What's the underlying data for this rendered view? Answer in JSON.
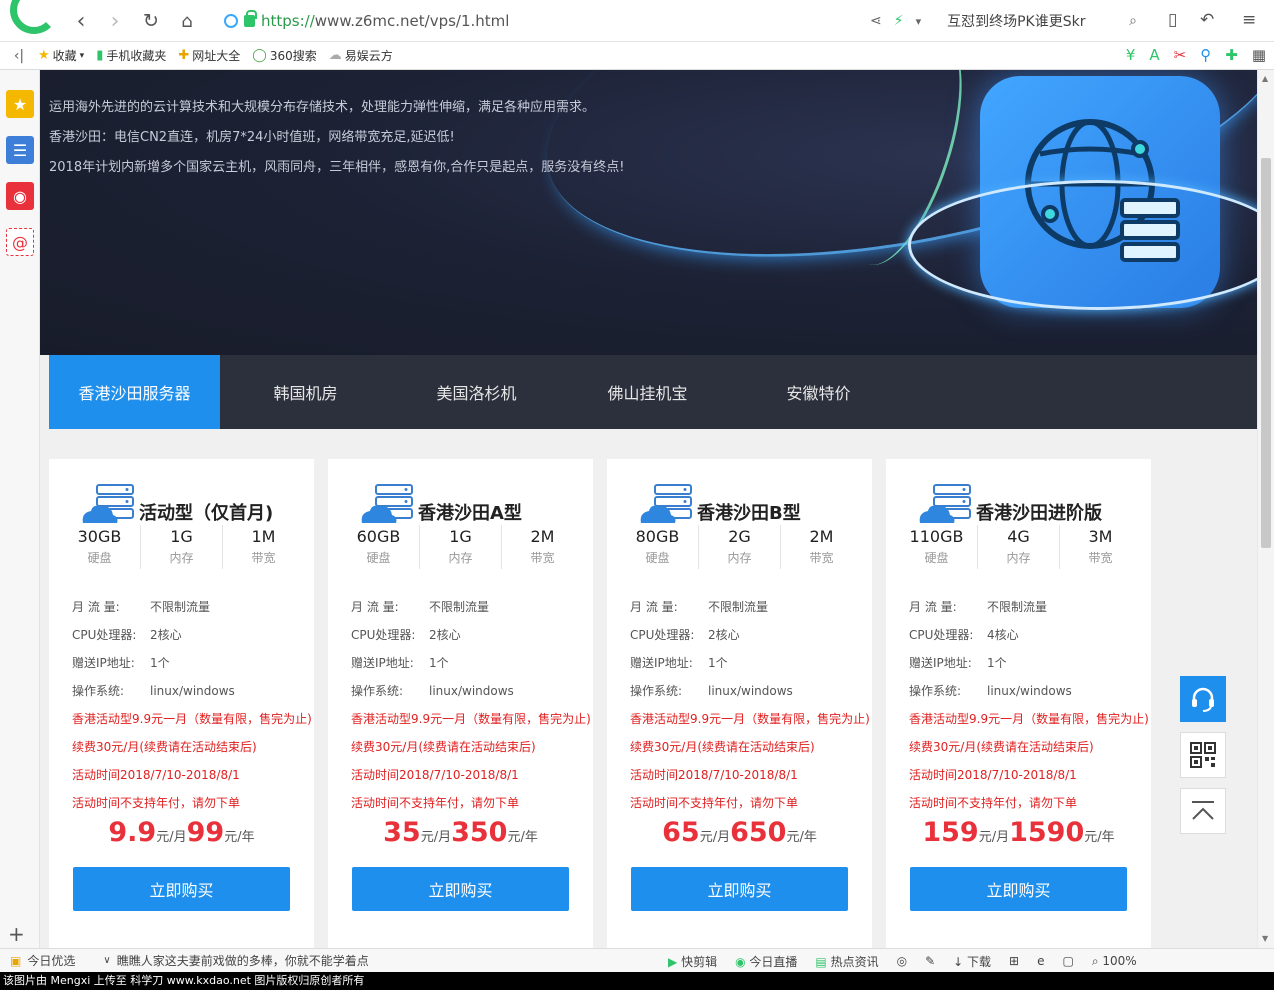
{
  "browser": {
    "url_prefix": "https://",
    "url_host": "www.z6mc.net",
    "url_path": "/vps/1.html",
    "news_ticker": "互怼到终场PK谁更Skr",
    "favorites": [
      {
        "icon": "star-icon",
        "label": "收藏"
      },
      {
        "icon": "phone-icon",
        "label": "手机收藏夹"
      },
      {
        "icon": "sites-icon",
        "label": "网址大全"
      },
      {
        "icon": "search-360-icon",
        "label": "360搜索"
      },
      {
        "icon": "cloud-icon",
        "label": "易娱云方"
      }
    ]
  },
  "banner": {
    "lines": [
      "运用海外先进的的云计算技术和大规模分布存储技术，处理能力弹性伸缩，满足各种应用需求。",
      "香港沙田：电信CN2直连，机房7*24小时值班，网络带宽充足,延迟低!",
      "2018年计划内新增多个国家云主机，风雨同舟，三年相伴，感恩有你,合作只是起点，服务没有终点!"
    ]
  },
  "tabs": [
    {
      "label": "香港沙田服务器",
      "active": true
    },
    {
      "label": "韩国机房",
      "active": false
    },
    {
      "label": "美国洛杉机",
      "active": false
    },
    {
      "label": "佛山挂机宝",
      "active": false
    },
    {
      "label": "安徽特价",
      "active": false
    }
  ],
  "spec_labels": {
    "disk": "硬盘",
    "ram": "内存",
    "bw": "带宽"
  },
  "feature_labels": {
    "traffic": "月 流 量:",
    "cpu": "CPU处理器:",
    "ip": "赠送IP地址:",
    "os": "操作系统:"
  },
  "price_units": {
    "month": "元/月",
    "year": "元/年"
  },
  "buy_label": "立即购买",
  "cards": [
    {
      "title": "活动型（仅首月)",
      "disk": "30GB",
      "ram": "1G",
      "bw": "1M",
      "traffic": "不限制流量",
      "cpu": "2核心",
      "ip": "1个",
      "os": "linux/windows",
      "notes": [
        "香港活动型9.9元一月（数量有限，售完为止)",
        "续费30元/月(续费请在活动结束后)",
        "活动时间2018/7/10-2018/8/1",
        "活动时间不支持年付，请勿下单"
      ],
      "price_month": "9.9",
      "price_year": "99"
    },
    {
      "title": "香港沙田A型",
      "disk": "60GB",
      "ram": "1G",
      "bw": "2M",
      "traffic": "不限制流量",
      "cpu": "2核心",
      "ip": "1个",
      "os": "linux/windows",
      "notes": [
        "香港活动型9.9元一月（数量有限，售完为止)",
        "续费30元/月(续费请在活动结束后)",
        "活动时间2018/7/10-2018/8/1",
        "活动时间不支持年付，请勿下单"
      ],
      "price_month": "35",
      "price_year": "350"
    },
    {
      "title": "香港沙田B型",
      "disk": "80GB",
      "ram": "2G",
      "bw": "2M",
      "traffic": "不限制流量",
      "cpu": "2核心",
      "ip": "1个",
      "os": "linux/windows",
      "notes": [
        "香港活动型9.9元一月（数量有限，售完为止)",
        "续费30元/月(续费请在活动结束后)",
        "活动时间2018/7/10-2018/8/1",
        "活动时间不支持年付，请勿下单"
      ],
      "price_month": "65",
      "price_year": "650"
    },
    {
      "title": "香港沙田进阶版",
      "disk": "110GB",
      "ram": "4G",
      "bw": "3M",
      "traffic": "不限制流量",
      "cpu": "4核心",
      "ip": "1个",
      "os": "linux/windows",
      "notes": [
        "香港活动型9.9元一月（数量有限，售完为止)",
        "续费30元/月(续费请在活动结束后)",
        "活动时间2018/7/10-2018/8/1",
        "活动时间不支持年付，请勿下单"
      ],
      "price_month": "159",
      "price_year": "1590"
    }
  ],
  "statusbar": {
    "today_pick": "今日优选",
    "headline": "瞧瞧人家这夫妻前戏做的多棒，你就不能学着点",
    "items": [
      "快剪辑",
      "今日直播",
      "热点资讯",
      "下载"
    ],
    "zoom": "100%"
  },
  "caption": "该图片由 Mengxi 上传至 科学刀 www.kxdao.net 图片版权归原创者所有",
  "colors": {
    "accent": "#1e8fec",
    "price_red": "#e8313a",
    "note_red": "#e02020",
    "tab_bar": "#2c303c"
  }
}
